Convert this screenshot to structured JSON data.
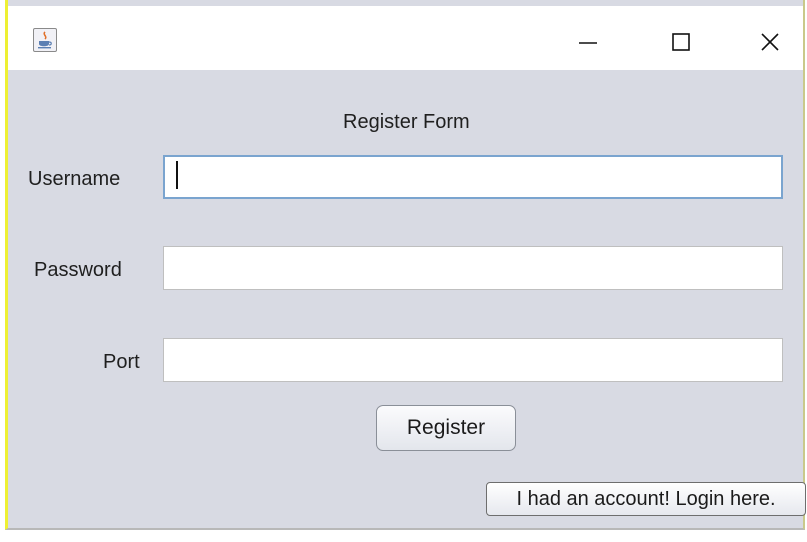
{
  "window": {
    "app_icon": "java-coffee-icon",
    "controls": {
      "minimize_icon": "minimize-icon",
      "maximize_icon": "maximize-icon",
      "close_icon": "close-icon"
    }
  },
  "form": {
    "title": "Register Form",
    "fields": {
      "username_label": "Username",
      "username_value": "",
      "password_label": "Password",
      "password_value": "",
      "port_label": "Port",
      "port_value": ""
    },
    "register_button": "Register",
    "login_button": "I had an account! Login here."
  },
  "colors": {
    "window_bg": "#d8dae3",
    "focus_border": "#7aa4cf",
    "window_edge_highlight": "#eef033"
  }
}
